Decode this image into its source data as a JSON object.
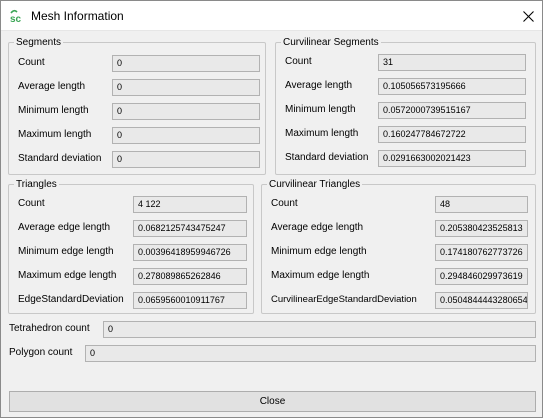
{
  "window": {
    "title": "Mesh Information",
    "app_icon": "sc-logo-icon",
    "close_icon": "close-icon"
  },
  "segments": {
    "title": "Segments",
    "rows": [
      {
        "label": "Count",
        "value": "0"
      },
      {
        "label": "Average length",
        "value": "0"
      },
      {
        "label": "Minimum length",
        "value": "0"
      },
      {
        "label": "Maximum length",
        "value": "0"
      },
      {
        "label": "Standard deviation",
        "value": "0"
      }
    ]
  },
  "curvilinear_segments": {
    "title": "Curvilinear Segments",
    "rows": [
      {
        "label": "Count",
        "value": "31"
      },
      {
        "label": "Average length",
        "value": "0.105056573195666"
      },
      {
        "label": "Minimum length",
        "value": "0.0572000739515167"
      },
      {
        "label": "Maximum length",
        "value": "0.160247784672722"
      },
      {
        "label": "Standard deviation",
        "value": "0.0291663002021423"
      }
    ]
  },
  "triangles": {
    "title": "Triangles",
    "rows": [
      {
        "label": "Count",
        "value": "4 122"
      },
      {
        "label": "Average edge length",
        "value": "0.0682125743475247"
      },
      {
        "label": "Minimum edge length",
        "value": "0.00396418959946726"
      },
      {
        "label": "Maximum edge length",
        "value": "0.278089865262846"
      },
      {
        "label": "EdgeStandardDeviation",
        "value": "0.0659560010911767"
      }
    ]
  },
  "curvilinear_triangles": {
    "title": "Curvilinear Triangles",
    "rows": [
      {
        "label": "Count",
        "value": "48"
      },
      {
        "label": "Average edge length",
        "value": "0.205380423525813"
      },
      {
        "label": "Minimum edge length",
        "value": "0.174180762773726"
      },
      {
        "label": "Maximum edge length",
        "value": "0.294846029973619"
      },
      {
        "label": "CurvilinearEdgeStandardDeviation",
        "value": "0.0504844443280654"
      }
    ]
  },
  "tetrahedron": {
    "label": "Tetrahedron count",
    "value": "0"
  },
  "polygon": {
    "label": "Polygon count",
    "value": "0"
  },
  "close_button": {
    "label": "Close"
  }
}
